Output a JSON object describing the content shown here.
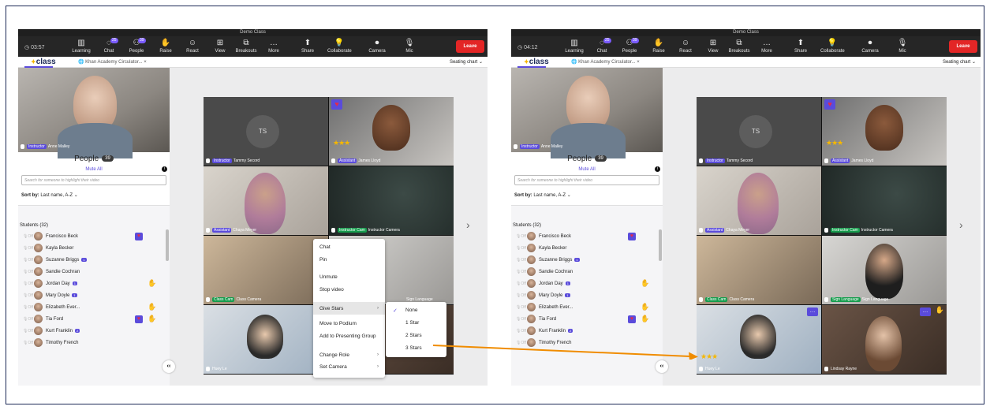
{
  "window_title": "Demo Class",
  "left": {
    "timer": "03:57"
  },
  "right": {
    "timer": "04:12"
  },
  "toolbar": [
    {
      "label": "Learning",
      "icon": "learning-icon"
    },
    {
      "label": "Chat",
      "icon": "chat-icon",
      "badge": "25"
    },
    {
      "label": "People",
      "icon": "people-icon",
      "badge": "39"
    },
    {
      "label": "Raise",
      "icon": "raise-hand-icon"
    },
    {
      "label": "React",
      "icon": "react-icon"
    },
    {
      "label": "View",
      "icon": "view-icon"
    },
    {
      "label": "Breakouts",
      "icon": "breakouts-icon"
    },
    {
      "label": "More",
      "icon": "more-icon"
    },
    {
      "label": "Share",
      "icon": "share-icon"
    },
    {
      "label": "Collaborate",
      "icon": "collaborate-icon"
    },
    {
      "label": "Camera",
      "icon": "camera-icon"
    },
    {
      "label": "Mic",
      "icon": "mic-icon"
    }
  ],
  "leave_label": "Leave",
  "logo": "class",
  "tab_title": "Khan Academy Circulator...",
  "tab_close": "×",
  "seating": "Seating chart",
  "instructor": {
    "role": "Instructor",
    "name": "Anne Malley"
  },
  "people": {
    "label": "People",
    "count": "39",
    "mute_all": "Mute All",
    "info": "i",
    "search_placeholder": "Search for someone to highlight their video",
    "sort_label": "Sort by:",
    "sort_value": "Last name, A-Z"
  },
  "students": {
    "header": "Students (32)",
    "mic_label": "Off",
    "rows": [
      {
        "name": "Francisco Beck"
      },
      {
        "name": "Kayla Becker"
      },
      {
        "name": "Suzanne Briggs",
        "badge": "1"
      },
      {
        "name": "Sandie Cochran"
      },
      {
        "name": "Jordan Day",
        "badge": "1"
      },
      {
        "name": "Mary Doyle",
        "badge": "1"
      },
      {
        "name": "Elizabeth Ever..."
      },
      {
        "name": "Tia Ford"
      },
      {
        "name": "Kurt Franklin",
        "badge": "2"
      },
      {
        "name": "Timothy French"
      }
    ]
  },
  "tiles_left": [
    {
      "role": "Instructor",
      "name": "Tammy Secord",
      "initials": "TS"
    },
    {
      "role": "Assistant",
      "name": "James Lloyd"
    },
    {
      "role": "Assistant",
      "name": "Chaya Meyer"
    },
    {
      "role": "Instructor Cam",
      "name": "Instructor Camera"
    },
    {
      "role": "Class Cam",
      "name": "Class Camera"
    },
    {
      "role": "Sign Language",
      "name": "Sign Language"
    },
    {
      "role": "",
      "name": "Huey Le"
    },
    {
      "role": "",
      "name": ""
    }
  ],
  "tiles_right": [
    {
      "role": "Instructor",
      "name": "Tammy Secord",
      "initials": "TS"
    },
    {
      "role": "Assistant",
      "name": "James Lloyd"
    },
    {
      "role": "Assistant",
      "name": "Chaya Meyer"
    },
    {
      "role": "Instructor Cam",
      "name": "Instructor Camera"
    },
    {
      "role": "Class Cam",
      "name": "Class Camera"
    },
    {
      "role": "Sign Language",
      "name": "Sign Language"
    },
    {
      "role": "",
      "name": "Huey Le"
    },
    {
      "role": "",
      "name": "Lindsay Rayne"
    }
  ],
  "menu": [
    "Chat",
    "Pin",
    "Unmute",
    "Stop video",
    "Give Stars",
    "Move to Podium",
    "Add to Presenting Group",
    "Change Role",
    "Set Camera"
  ],
  "stars_menu": [
    "None",
    "1 Star",
    "2 Stars",
    "3 Stars"
  ],
  "stars_glyph": "★★★",
  "colors": {
    "accent": "#5a4bdb",
    "leave": "#e32626",
    "arrow": "#f08c00",
    "star": "#f5b700"
  }
}
